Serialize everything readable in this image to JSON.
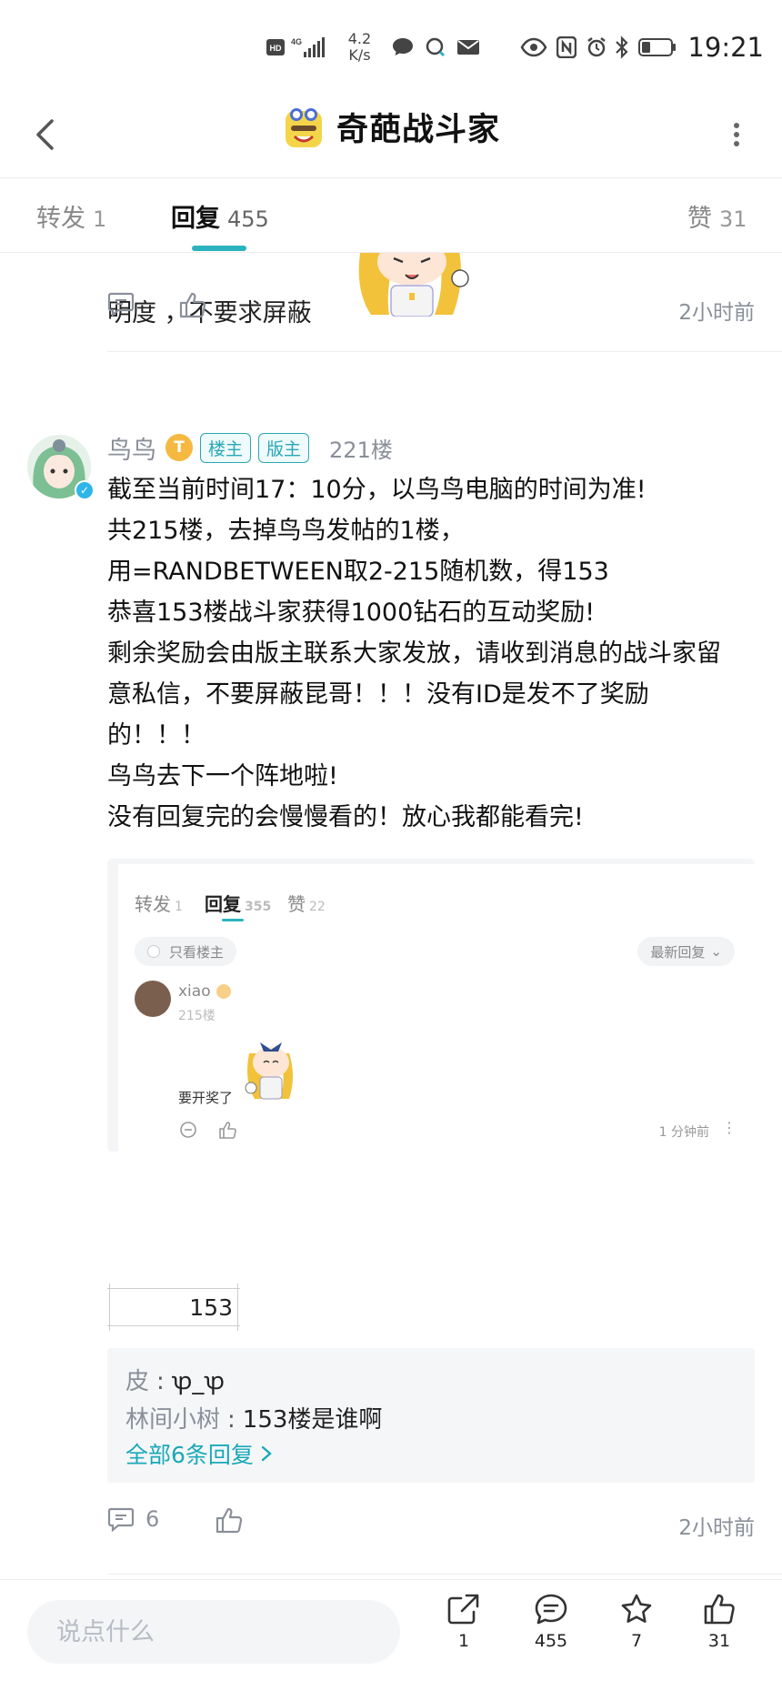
{
  "status_bar": {
    "hd": "HD",
    "network_type": "4G",
    "speed_value": "4.2",
    "speed_unit": "K/s",
    "time": "19:21"
  },
  "header": {
    "title": "奇葩战斗家"
  },
  "tabs": [
    {
      "label": "转发",
      "count": "1"
    },
    {
      "label": "回复",
      "count": "455"
    },
    {
      "label": "赞",
      "count": "31"
    }
  ],
  "previous_comment": {
    "text": "明度 ，不要求屏蔽",
    "time": "2小时前"
  },
  "comment": {
    "user": "鸟鸟",
    "level": "T",
    "badges": [
      "楼主",
      "版主"
    ],
    "floor": "221楼",
    "lines": [
      "截至当前时间17：10分，以鸟鸟电脑的时间为准!",
      "共215楼，去掉鸟鸟发帖的1楼，",
      "用=RANDBETWEEN取2-215随机数，得153",
      "恭喜153楼战斗家获得1000钻石的互动奖励!",
      "剩余奖励会由版主联系大家发放，请收到消息的战斗家留",
      "意私信，不要屏蔽昆哥！！！没有ID是发不了奖励",
      "的！！！",
      "鸟鸟去下一个阵地啦!",
      "没有回复完的会慢慢看的！放心我都能看完!"
    ],
    "embedded_screenshot": {
      "tabs": [
        {
          "label": "转发",
          "count": "1"
        },
        {
          "label": "回复",
          "count": "355"
        },
        {
          "label": "赞",
          "count": "22"
        }
      ],
      "filter_label": "只看楼主",
      "sort_label": "最新回复",
      "user": "xiao",
      "floor": "215楼",
      "text": "要开奖了",
      "time": "1 分钟前"
    },
    "cell_value": "153",
    "replies": [
      {
        "user": "皮",
        "text": "ꝕ_ꝕ"
      },
      {
        "user": "林间小树",
        "text": "153楼是谁啊"
      }
    ],
    "all_replies_label": "全部6条回复",
    "comment_count": "6",
    "time": "2小时前"
  },
  "bottom_bar": {
    "input_placeholder": "说点什么",
    "share_count": "1",
    "comment_count": "455",
    "favorite_count": "7",
    "like_count": "31"
  },
  "colors": {
    "accent": "#2bb3c0",
    "muted_text": "#8a8f99",
    "reply_bg": "#f5f6f8"
  }
}
